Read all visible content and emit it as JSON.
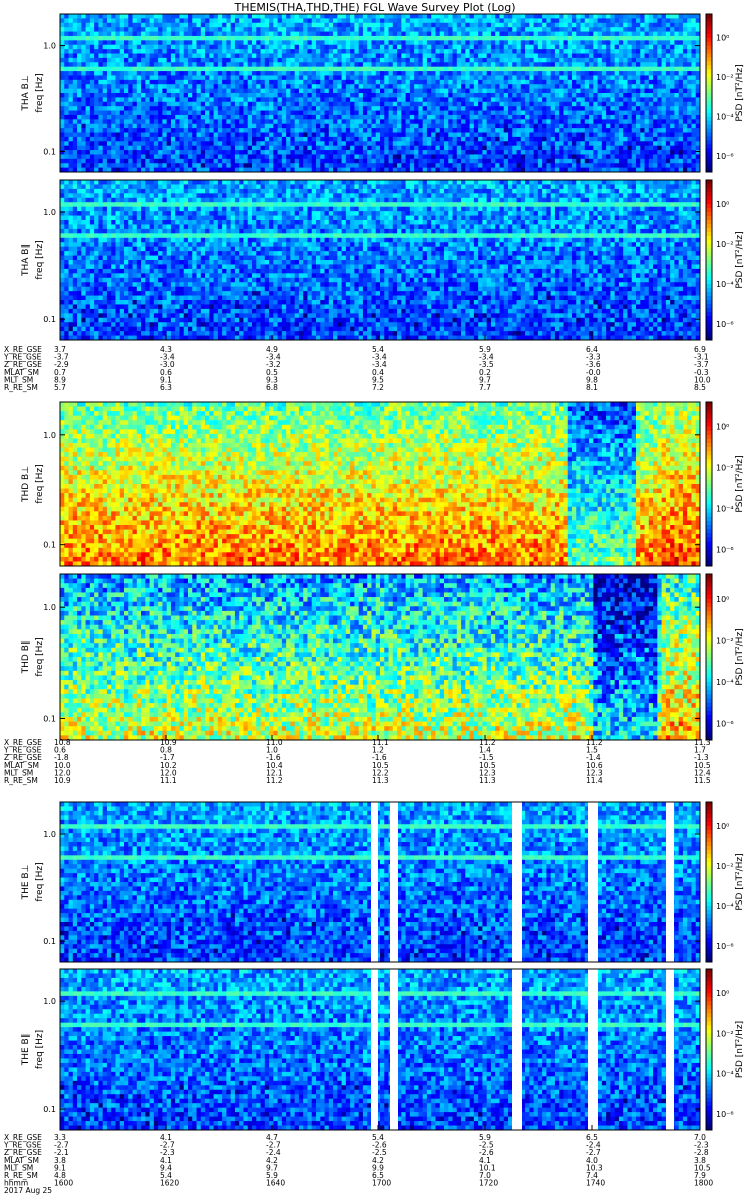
{
  "title": "THEMIS(THA,THD,THE) FGL Wave Survey Plot (Log)",
  "chart_data": {
    "type": "heatmap",
    "yscale": "log",
    "ytick_labels": [
      "1.0",
      "0.1"
    ],
    "colorbar_label": "PSD [nT²/Hz]",
    "colorbar_ticks": [
      "10⁰",
      "10⁻²",
      "10⁻⁴",
      "10⁻⁶"
    ],
    "panels": [
      {
        "probe": "THA",
        "probe_label": "THA B⊥",
        "ylabel": "freq [Hz]",
        "level": "low"
      },
      {
        "probe": "THA",
        "probe_label": "THA B∥",
        "ylabel": "freq [Hz]",
        "level": "low"
      },
      {
        "probe": "THD",
        "probe_label": "THD B⊥",
        "ylabel": "freq [Hz]",
        "level": "high"
      },
      {
        "probe": "THD",
        "probe_label": "THD B∥",
        "ylabel": "freq [Hz]",
        "level": "mixed"
      },
      {
        "probe": "THE",
        "probe_label": "THE B⊥",
        "ylabel": "freq [Hz]",
        "level": "low"
      },
      {
        "probe": "THE",
        "probe_label": "THE B∥",
        "ylabel": "freq [Hz]",
        "level": "low"
      }
    ],
    "ephemeris_groups": [
      {
        "probe": "THA",
        "rows": [
          {
            "label": "X_RE_GSE",
            "values": [
              "3.7",
              "4.3",
              "4.9",
              "5.4",
              "5.9",
              "6.4",
              "6.9"
            ]
          },
          {
            "label": "Y_RE_GSE",
            "values": [
              "-3.7",
              "-3.4",
              "-3.4",
              "-3.4",
              "-3.4",
              "-3.3",
              "-3.1"
            ]
          },
          {
            "label": "Z_RE_GSE",
            "values": [
              "-2.9",
              "-3.0",
              "-3.2",
              "-3.4",
              "-3.5",
              "-3.6",
              "-3.7"
            ]
          },
          {
            "label": "MLAT_SM",
            "values": [
              "0.7",
              "0.6",
              "0.5",
              "0.4",
              "0.2",
              "-0.0",
              "-0.3"
            ]
          },
          {
            "label": "MLT_SM",
            "values": [
              "8.9",
              "9.1",
              "9.3",
              "9.5",
              "9.7",
              "9.8",
              "10.0"
            ]
          },
          {
            "label": "R_RE_SM",
            "values": [
              "5.7",
              "6.3",
              "6.8",
              "7.2",
              "7.7",
              "8.1",
              "8.5"
            ]
          }
        ]
      },
      {
        "probe": "THD",
        "rows": [
          {
            "label": "X_RE_GSE",
            "values": [
              "10.8",
              "10.9",
              "11.0",
              "11.1",
              "11.2",
              "11.2",
              "11.3"
            ]
          },
          {
            "label": "Y_RE_GSE",
            "values": [
              "0.6",
              "0.8",
              "1.0",
              "1.2",
              "1.4",
              "1.5",
              "1.7"
            ]
          },
          {
            "label": "Z_RE_GSE",
            "values": [
              "-1.8",
              "-1.7",
              "-1.6",
              "-1.6",
              "-1.5",
              "-1.4",
              "-1.3"
            ]
          },
          {
            "label": "MLAT_SM",
            "values": [
              "10.0",
              "10.2",
              "10.4",
              "10.5",
              "10.5",
              "10.6",
              "10.5"
            ]
          },
          {
            "label": "MLT_SM",
            "values": [
              "12.0",
              "12.0",
              "12.1",
              "12.2",
              "12.3",
              "12.3",
              "12.4"
            ]
          },
          {
            "label": "R_RE_SM",
            "values": [
              "10.9",
              "11.1",
              "11.2",
              "11.3",
              "11.3",
              "11.4",
              "11.5"
            ]
          }
        ]
      },
      {
        "probe": "THE",
        "rows": [
          {
            "label": "X_RE_GSE",
            "values": [
              "3.3",
              "4.1",
              "4.7",
              "5.4",
              "5.9",
              "6.5",
              "7.0"
            ]
          },
          {
            "label": "Y_RE_GSE",
            "values": [
              "-2.7",
              "-2.7",
              "-2.7",
              "-2.6",
              "-2.5",
              "-2.4",
              "-2.3"
            ]
          },
          {
            "label": "Z_RE_GSE",
            "values": [
              "-2.1",
              "-2.3",
              "-2.4",
              "-2.5",
              "-2.6",
              "-2.7",
              "-2.8"
            ]
          },
          {
            "label": "MLAT_SM",
            "values": [
              "3.8",
              "4.1",
              "4.2",
              "4.2",
              "4.1",
              "4.0",
              "3.8"
            ]
          },
          {
            "label": "MLT_SM",
            "values": [
              "9.1",
              "9.4",
              "9.7",
              "9.9",
              "10.1",
              "10.3",
              "10.5"
            ]
          },
          {
            "label": "R_RE_SM",
            "values": [
              "4.8",
              "5.4",
              "5.9",
              "6.5",
              "7.0",
              "7.4",
              "7.9"
            ]
          }
        ]
      }
    ],
    "time_row": {
      "label": "hhmm",
      "values": [
        "1600",
        "1620",
        "1640",
        "1700",
        "1720",
        "1740",
        "1800"
      ]
    },
    "date_label": "2017 Aug 25"
  }
}
